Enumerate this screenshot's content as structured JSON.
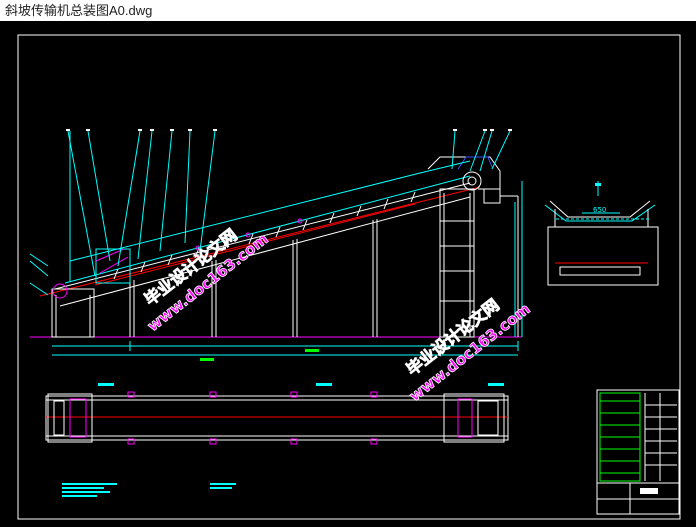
{
  "window": {
    "title": "斜坡传输机总装图A0.dwg"
  },
  "drawing": {
    "dimension_section_width": "650",
    "colors": {
      "background": "#000000",
      "frame": "#ffffff",
      "leader": "#00ffff",
      "centerline": "#ff0000",
      "structure": "#ffffff",
      "ground": "#ff00ff",
      "watermark": "#ff00ff",
      "watermark_outline": "#ffffff",
      "title_block": "#00ff00"
    }
  },
  "watermarks": [
    {
      "line1": "毕业设计论文网",
      "line2": "www.doc163.com"
    },
    {
      "line1": "毕业设计论文网",
      "line2": "www.doc163.com"
    }
  ]
}
